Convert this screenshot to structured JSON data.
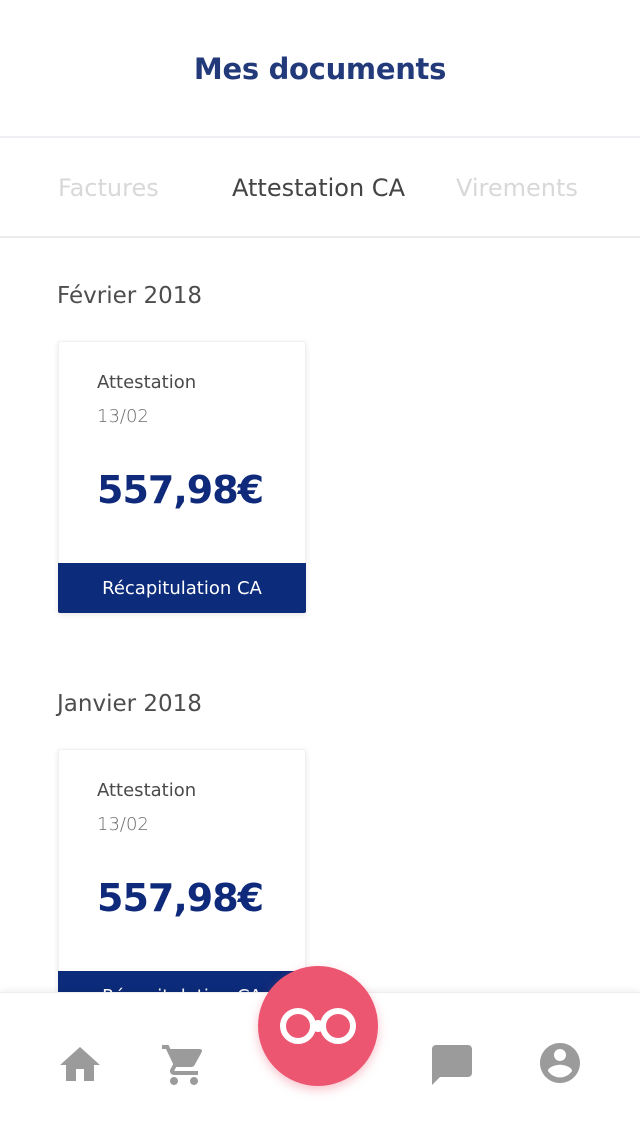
{
  "header": {
    "title": "Mes documents"
  },
  "tabs": [
    {
      "label": "Factures",
      "active": false
    },
    {
      "label": "Attestation CA",
      "active": true
    },
    {
      "label": "Virements",
      "active": false
    }
  ],
  "sections": [
    {
      "month": "Février 2018",
      "card": {
        "label": "Attestation",
        "date": "13/02",
        "amount": "557,98€",
        "button": "Récapitulation CA"
      }
    },
    {
      "month": "Janvier 2018",
      "card": {
        "label": "Attestation",
        "date": "13/02",
        "amount": "557,98€",
        "button": "Récapitulation CA"
      }
    }
  ],
  "bottom_nav": {
    "items": [
      {
        "icon": "home-icon"
      },
      {
        "icon": "cart-icon"
      },
      {
        "icon": "chat-icon"
      },
      {
        "icon": "profile-icon"
      }
    ],
    "fab_icon": "infinity-logo-icon"
  },
  "colors": {
    "brand_blue": "#0c2b7a",
    "title_blue": "#223a7a",
    "fab_pink": "#ec5671",
    "icon_grey": "#9b9b9b"
  }
}
